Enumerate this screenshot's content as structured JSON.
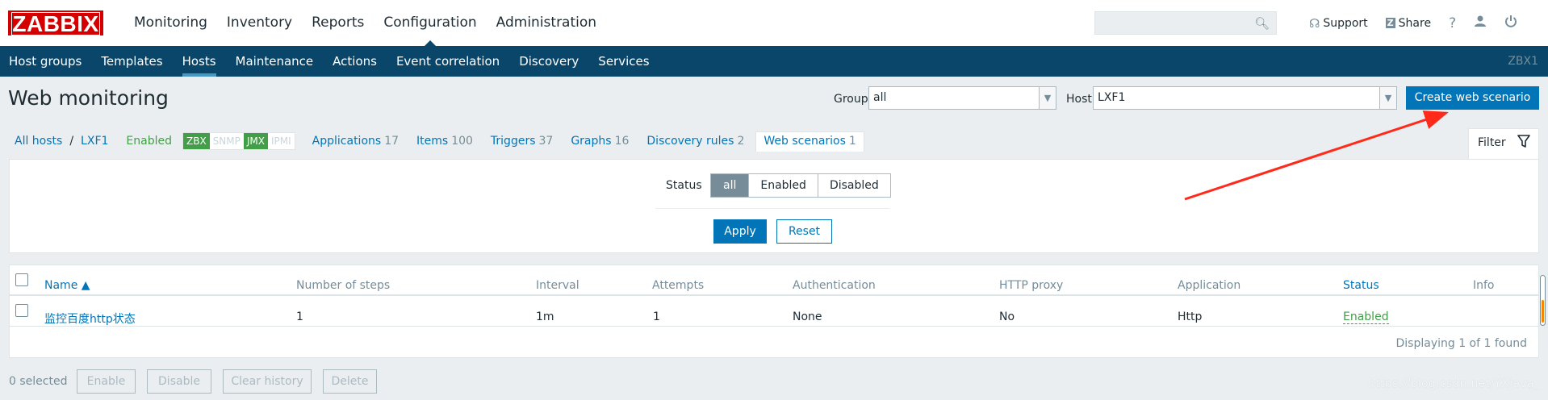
{
  "logo": "ZABBIX",
  "main_nav": [
    "Monitoring",
    "Inventory",
    "Reports",
    "Configuration",
    "Administration"
  ],
  "top_links": {
    "support": "Support",
    "share": "Share",
    "help": "?"
  },
  "sub_nav": [
    "Host groups",
    "Templates",
    "Hosts",
    "Maintenance",
    "Actions",
    "Event correlation",
    "Discovery",
    "Services"
  ],
  "server_name": "ZBX1",
  "page_title": "Web monitoring",
  "group_label": "Group",
  "group_value": "all",
  "host_label": "Host",
  "host_value": "LXF1",
  "create_button": "Create web scenario",
  "breadcrumbs": {
    "all_hosts": "All hosts",
    "separator": "/",
    "host": "LXF1",
    "status": "Enabled",
    "availability": [
      "ZBX",
      "SNMP",
      "JMX",
      "IPMI"
    ],
    "links": [
      {
        "label": "Applications",
        "count": "17"
      },
      {
        "label": "Items",
        "count": "100"
      },
      {
        "label": "Triggers",
        "count": "37"
      },
      {
        "label": "Graphs",
        "count": "16"
      },
      {
        "label": "Discovery rules",
        "count": "2"
      },
      {
        "label": "Web scenarios",
        "count": "1"
      }
    ]
  },
  "filter": {
    "tab_label": "Filter",
    "status_label": "Status",
    "options": [
      "all",
      "Enabled",
      "Disabled"
    ],
    "apply": "Apply",
    "reset": "Reset"
  },
  "table": {
    "headers": [
      "Name ▲",
      "Number of steps",
      "Interval",
      "Attempts",
      "Authentication",
      "HTTP proxy",
      "Application",
      "Status",
      "Info"
    ],
    "rows": [
      {
        "name": "监控百度http状态",
        "steps": "1",
        "interval": "1m",
        "attempts": "1",
        "authentication": "None",
        "http_proxy": "No",
        "application": "Http",
        "status": "Enabled"
      }
    ],
    "footer": "Displaying 1 of 1 found"
  },
  "bottom": {
    "selected": "0 selected",
    "buttons": [
      "Enable",
      "Disable",
      "Clear history",
      "Delete"
    ]
  },
  "watermark": "https://blog.csdn.net/YXjava_",
  "colors": {
    "brand_red": "#d40000",
    "nav_dark": "#0a466a",
    "link_blue": "#0275b8",
    "enabled_green": "#429e47",
    "annotation_arrow": "#ff2a1a"
  }
}
